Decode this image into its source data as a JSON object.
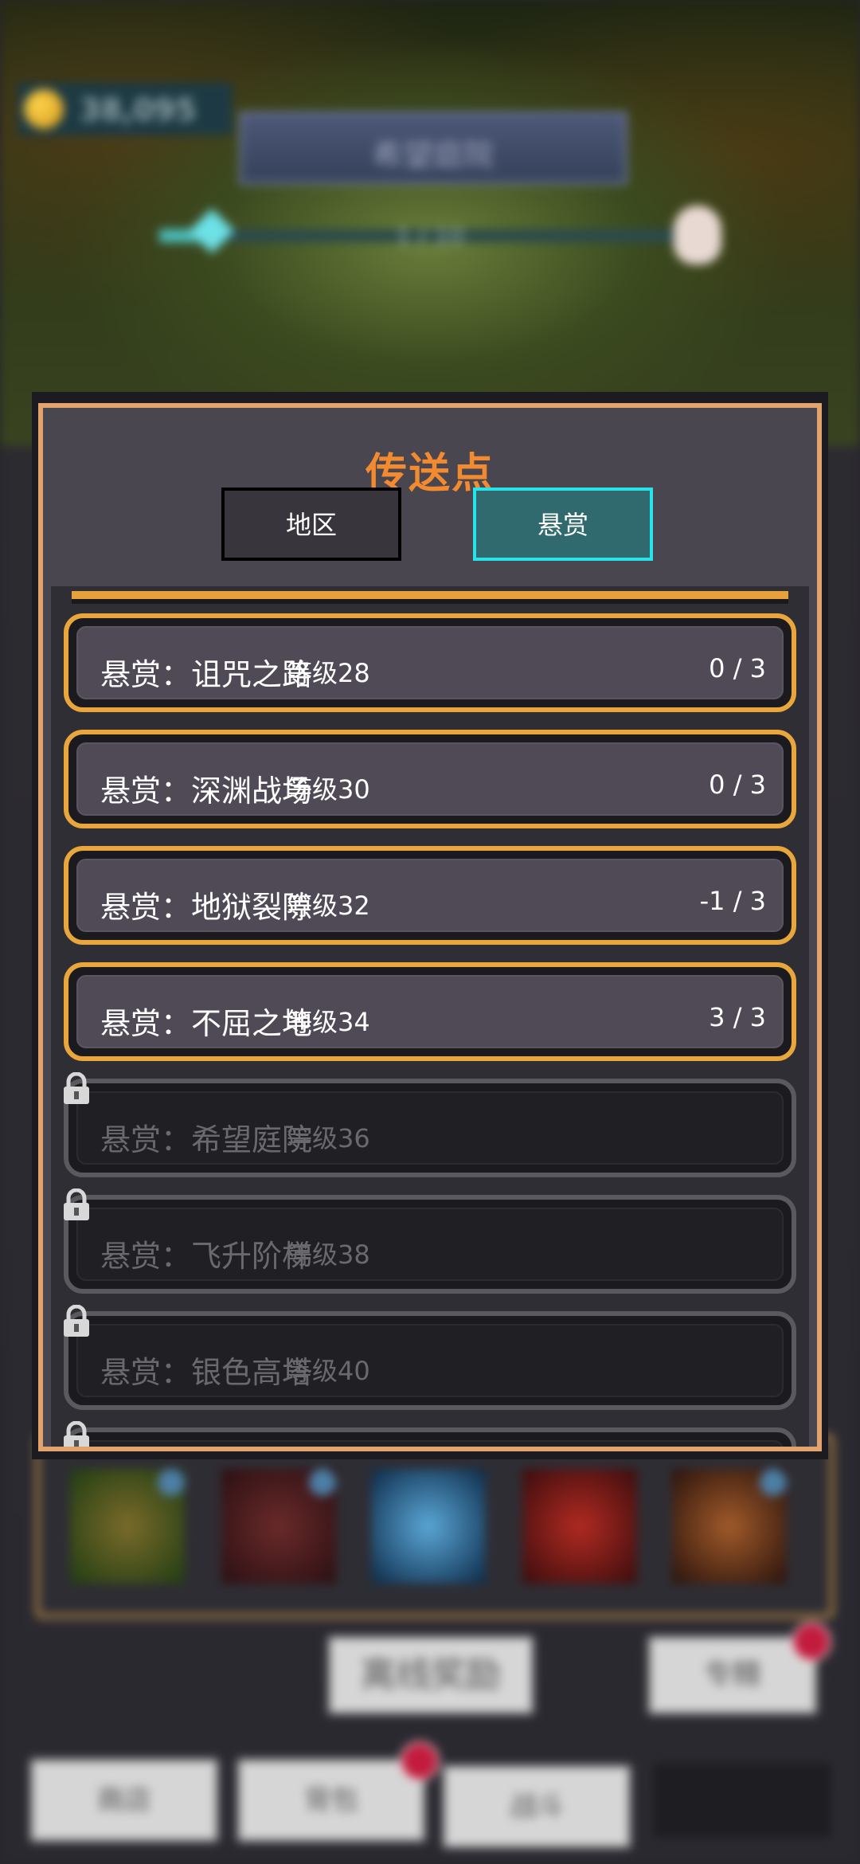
{
  "hud": {
    "gold": "38,095",
    "area_name": "希望庭院",
    "stage_progress_text": "1 / 10",
    "stage_progress_fraction": 0.1
  },
  "modal": {
    "title": "传送点",
    "tabs": [
      {
        "label": "地区",
        "active": false
      },
      {
        "label": "悬赏",
        "active": true
      }
    ],
    "bounties": [
      {
        "name": "悬赏：诅咒之路",
        "level": "等级28",
        "count": "0  /  3",
        "locked": false
      },
      {
        "name": "悬赏：深渊战场",
        "level": "等级30",
        "count": "0  /  3",
        "locked": false
      },
      {
        "name": "悬赏：地狱裂隙",
        "level": "等级32",
        "count": "-1  /  3",
        "locked": false
      },
      {
        "name": "悬赏：不屈之地",
        "level": "等级34",
        "count": "3  /  3",
        "locked": false
      },
      {
        "name": "悬赏：希望庭院",
        "level": "等级36",
        "count": "",
        "locked": true
      },
      {
        "name": "悬赏：飞升阶梯",
        "level": "等级38",
        "count": "",
        "locked": true
      },
      {
        "name": "悬赏：银色高塔",
        "level": "等级40",
        "count": "",
        "locked": true
      }
    ]
  },
  "bottom": {
    "offline_reward": "离线奖励",
    "specialize": "专精",
    "nav": [
      "商店",
      "背包",
      "战斗"
    ]
  },
  "colors": {
    "accent_orange": "#f28a30",
    "gold_border": "#e9a63c",
    "tab_active_border": "#27e3ea",
    "frame": "#e2a46c"
  }
}
